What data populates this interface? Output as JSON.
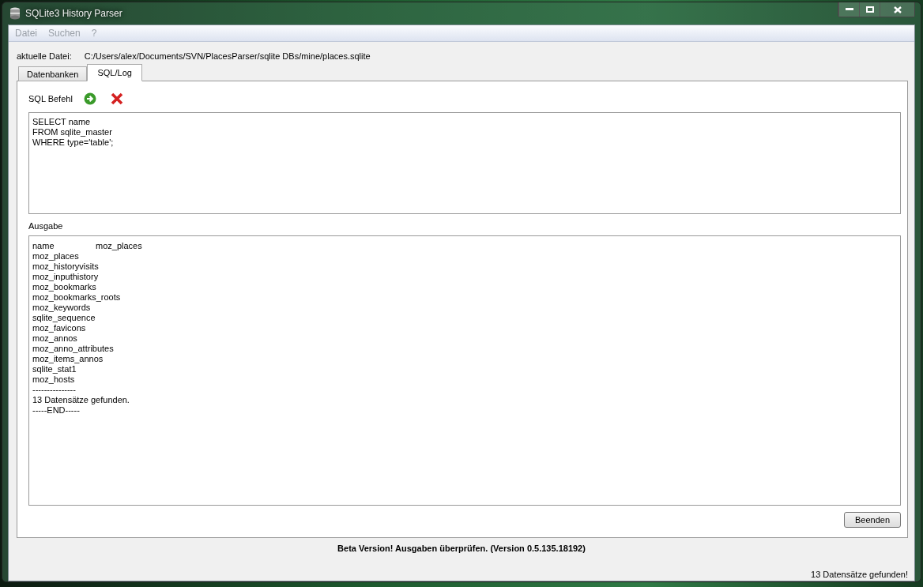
{
  "window": {
    "title": "SQLite3 History Parser"
  },
  "menu": [
    "Datei",
    "Suchen",
    "?"
  ],
  "current_file": {
    "label": "aktuelle Datei:",
    "path": "C:/Users/alex/Documents/SVN/PlacesParser/sqlite DBs/mine/places.sqlite"
  },
  "tabs": [
    {
      "label": "Datenbanken",
      "selected": false
    },
    {
      "label": "SQL/Log",
      "selected": true
    }
  ],
  "sql": {
    "label": "SQL Befehl",
    "query": [
      "SELECT name",
      "FROM sqlite_master",
      "WHERE type='table';"
    ]
  },
  "output": {
    "label": "Ausgabe",
    "header": [
      "name",
      "moz_places"
    ],
    "lines": [
      "moz_places",
      "moz_historyvisits",
      "moz_inputhistory",
      "moz_bookmarks",
      "moz_bookmarks_roots",
      "moz_keywords",
      "sqlite_sequence",
      "moz_favicons",
      "moz_annos",
      "moz_anno_attributes",
      "moz_items_annos",
      "sqlite_stat1",
      "moz_hosts",
      "---------------",
      "13 Datensätze gefunden.",
      "-----END-----"
    ]
  },
  "buttons": [
    "Beenden"
  ],
  "notice": "Beta Version! Ausgaben überprüfen. (Version 0.5.135.18192)",
  "status_bar": "13 Datensätze gefunden!"
}
